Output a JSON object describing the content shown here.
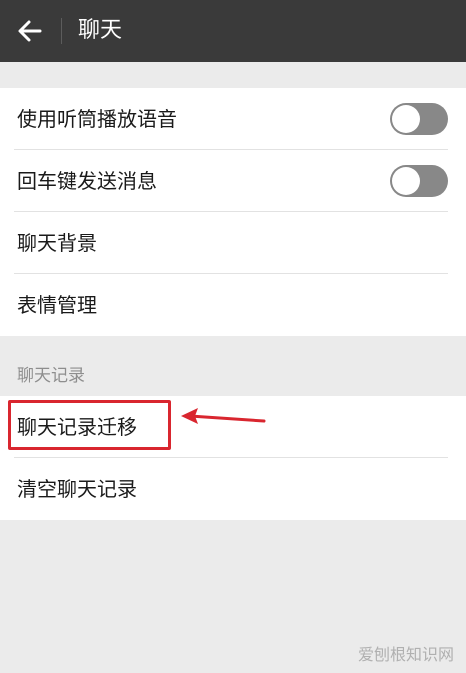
{
  "header": {
    "title": "聊天"
  },
  "settings": {
    "items": [
      {
        "label": "使用听筒播放语音",
        "toggle": "off"
      },
      {
        "label": "回车键发送消息",
        "toggle": "off"
      },
      {
        "label": "聊天背景"
      },
      {
        "label": "表情管理"
      }
    ]
  },
  "history": {
    "section_label": "聊天记录",
    "items": [
      {
        "label": "聊天记录迁移"
      },
      {
        "label": "清空聊天记录"
      }
    ]
  },
  "annotation_color": "#d9262f",
  "watermark": "爱刨根知识网"
}
